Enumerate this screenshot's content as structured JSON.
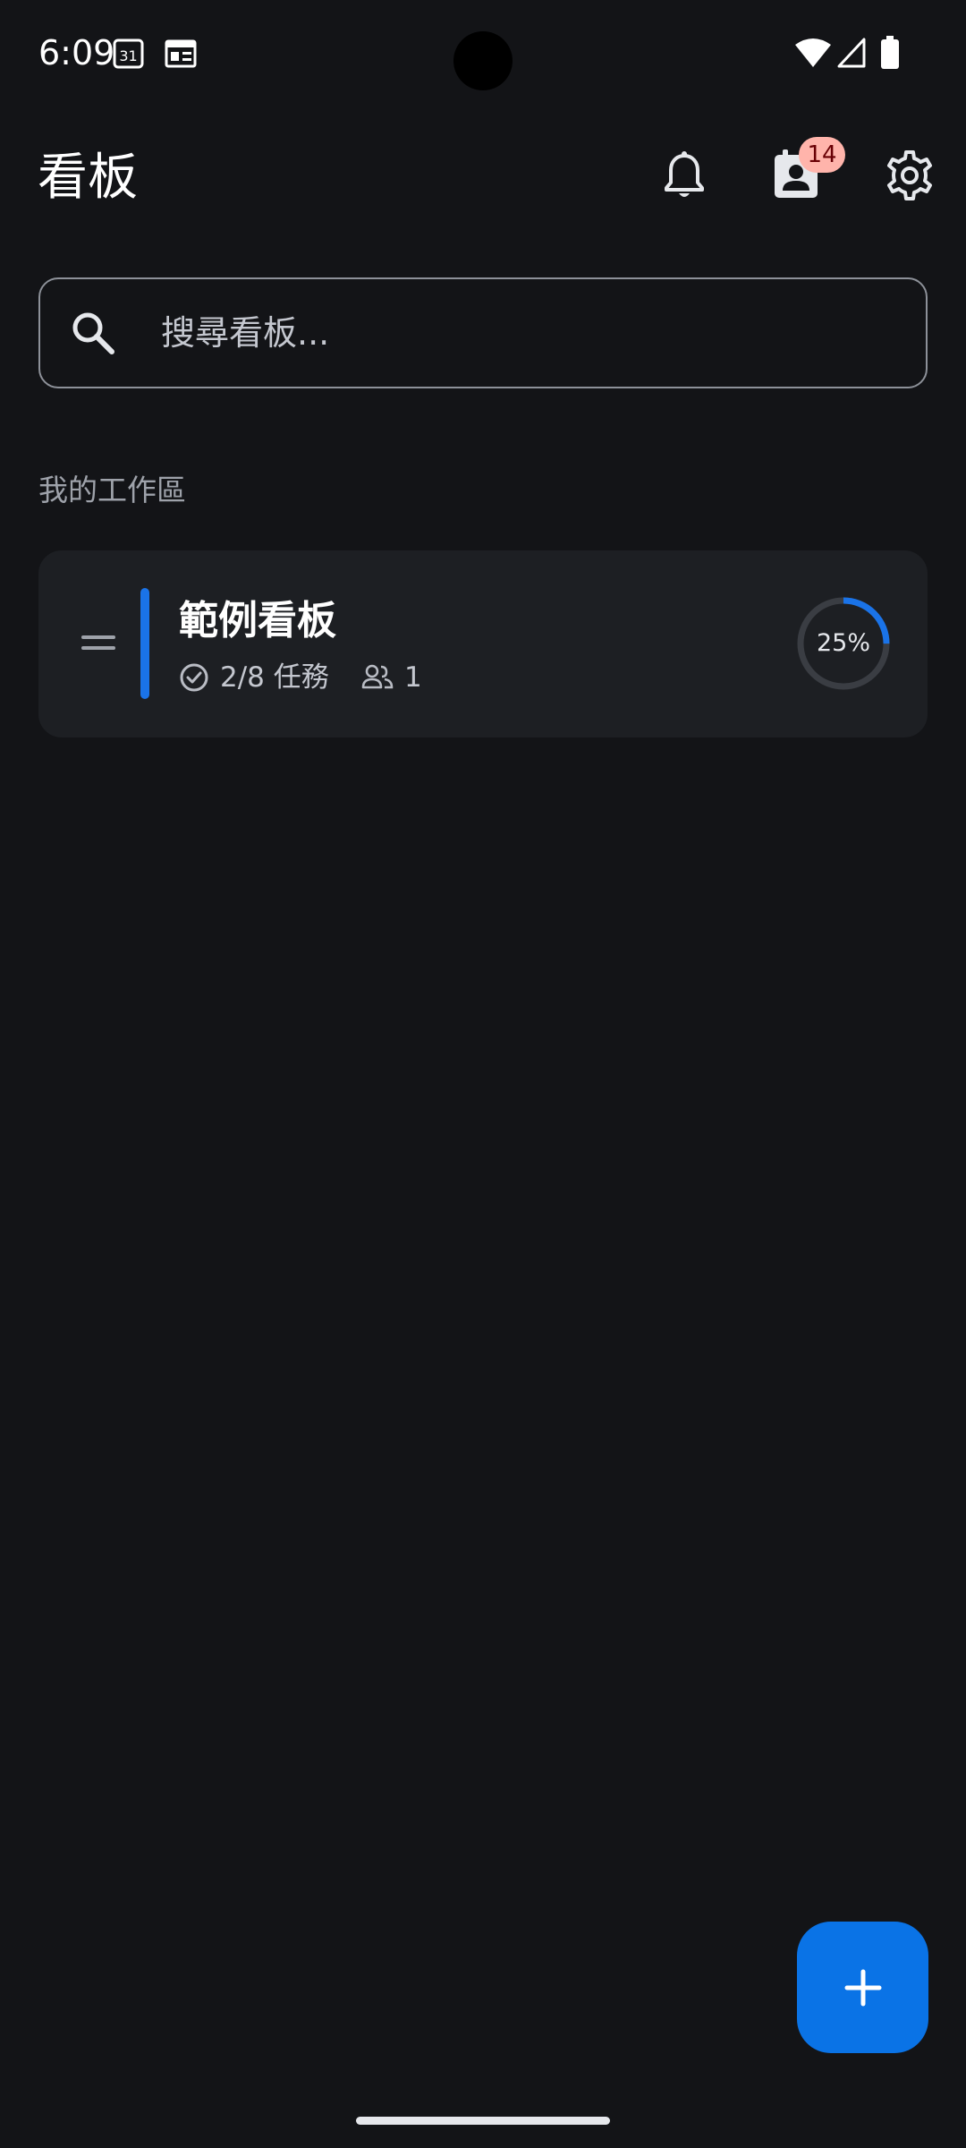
{
  "status_bar": {
    "time": "6:09",
    "calendar_icon": "calendar-31-icon",
    "calendar_day": "31",
    "news_icon": "news-icon",
    "wifi_icon": "wifi-icon",
    "signal_icon": "cell-signal-icon",
    "battery_icon": "battery-icon"
  },
  "app_bar": {
    "title": "看板",
    "notifications_icon": "bell-icon",
    "contacts_icon": "contact-card-icon",
    "contacts_badge": "14",
    "settings_icon": "gear-icon"
  },
  "search": {
    "placeholder": "搜尋看板...",
    "value": "",
    "icon": "search-icon"
  },
  "workspace": {
    "heading": "我的工作區",
    "boards": [
      {
        "name": "範例看板",
        "tasks_text": "2/8 任務",
        "members_count": "1",
        "progress_percent": 25,
        "progress_label": "25%",
        "accent_color": "#1a73e8"
      }
    ]
  },
  "fab": {
    "icon": "plus-icon"
  },
  "colors": {
    "background": "#131417",
    "card": "#1d1f23",
    "primary": "#0a73e6",
    "badge": "#ffb4ab"
  }
}
